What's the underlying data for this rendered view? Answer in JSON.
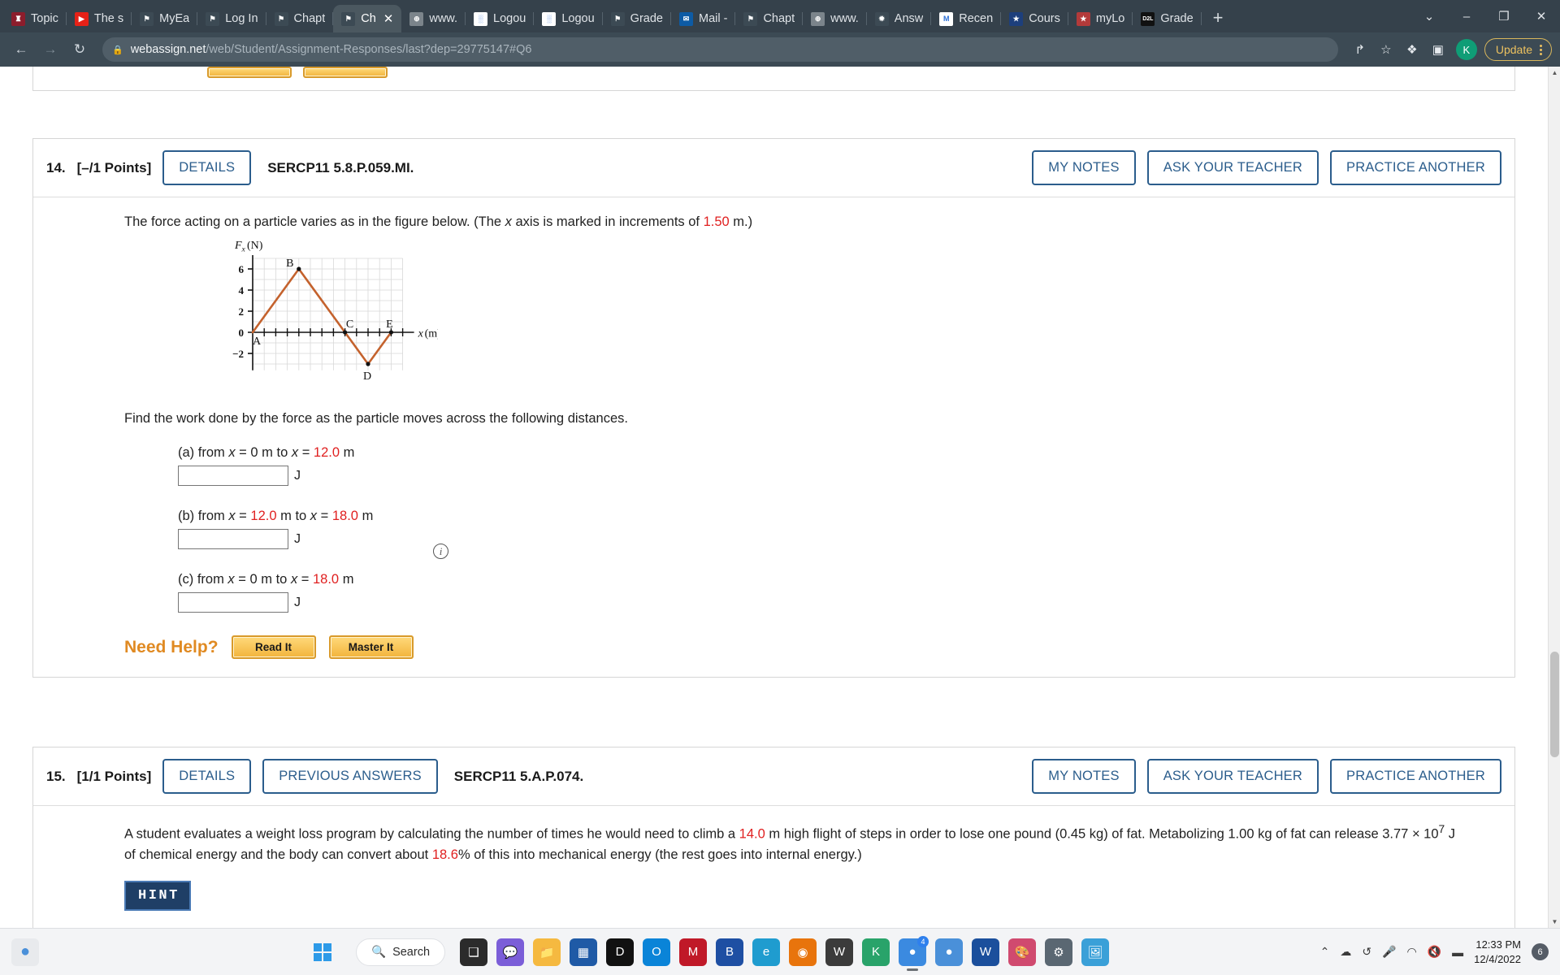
{
  "browser": {
    "tabs": [
      {
        "label": "Topic",
        "favicon": "maroon-shield-icon",
        "active": false
      },
      {
        "label": "The s",
        "favicon": "youtube-icon",
        "active": false
      },
      {
        "label": "MyEa",
        "favicon": "hcc-icon",
        "active": false
      },
      {
        "label": "Log In",
        "favicon": "hcc-icon",
        "active": false
      },
      {
        "label": "Chapt",
        "favicon": "hcc-icon",
        "active": false
      },
      {
        "label": "Ch",
        "favicon": "webassign-icon",
        "active": true
      },
      {
        "label": "www.",
        "favicon": "globe-icon",
        "active": false
      },
      {
        "label": "Logou",
        "favicon": "blue-pattern-icon",
        "active": false
      },
      {
        "label": "Logou",
        "favicon": "blue-pattern-icon",
        "active": false
      },
      {
        "label": "Grade",
        "favicon": "hcc-icon",
        "active": false
      },
      {
        "label": "Mail -",
        "favicon": "outlook-icon",
        "active": false
      },
      {
        "label": "Chapt",
        "favicon": "hcc-icon",
        "active": false
      },
      {
        "label": "www.",
        "favicon": "globe-icon",
        "active": false
      },
      {
        "label": "Answ",
        "favicon": "chegg-icon",
        "active": false
      },
      {
        "label": "Recen",
        "favicon": "gmail-icon",
        "active": false
      },
      {
        "label": "Cours",
        "favicon": "star-badge-icon",
        "active": false
      },
      {
        "label": "myLo",
        "favicon": "texas-icon",
        "active": false
      },
      {
        "label": "Grade",
        "favicon": "d2l-icon",
        "active": false
      }
    ],
    "tab_close_glyph": "✕",
    "new_tab_glyph": "+",
    "window_controls": [
      "⌄",
      "–",
      "❐",
      "✕"
    ],
    "nav": {
      "back_glyph": "←",
      "forward_glyph": "→",
      "reload_glyph": "↻",
      "lock_glyph": "🔒"
    },
    "url": {
      "domain": "webassign.net",
      "path": "/web/Student/Assignment-Responses/last?dep=29775147#Q6"
    },
    "toolbar": {
      "share_glyph": "↱",
      "bookmark_glyph": "☆",
      "extensions_glyph": "❖",
      "sidepanel_glyph": "▣",
      "profile_initial": "K",
      "update_label": "Update"
    }
  },
  "questions": [
    {
      "number": "14.",
      "points": "[–/1 Points]",
      "details_label": "DETAILS",
      "previous_answers_label": null,
      "code": "SERCP11 5.8.P.059.MI.",
      "right_buttons": [
        "MY NOTES",
        "ASK YOUR TEACHER",
        "PRACTICE ANOTHER"
      ],
      "prompt_pre": "The force acting on a particle varies as in the figure below. (The ",
      "prompt_italic": "x",
      "prompt_mid": " axis is marked in increments of ",
      "prompt_value": "1.50",
      "prompt_post": " m.)",
      "sub_prompt": "Find the work done by the force as the particle moves across the following distances.",
      "parts": [
        {
          "label": "(a) from ",
          "var1": "x",
          "eq1": " = ",
          "v1": "0",
          "u1": " m to ",
          "var2": "x",
          "eq2": " = ",
          "v2": "12.0",
          "u2": " m",
          "v1_red": false,
          "v2_red": true,
          "value": "",
          "unit": "J"
        },
        {
          "label": "(b) from ",
          "var1": "x",
          "eq1": " = ",
          "v1": "12.0",
          "u1": " m to ",
          "var2": "x",
          "eq2": " = ",
          "v2": "18.0",
          "u2": " m",
          "v1_red": true,
          "v2_red": true,
          "value": "",
          "unit": "J"
        },
        {
          "label": "(c) from ",
          "var1": "x",
          "eq1": " = ",
          "v1": "0",
          "u1": " m to ",
          "var2": "x",
          "eq2": " = ",
          "v2": "18.0",
          "u2": " m",
          "v1_red": false,
          "v2_red": true,
          "value": "",
          "unit": "J"
        }
      ],
      "need_help_label": "Need Help?",
      "help_buttons": [
        "Read It",
        "Master It"
      ],
      "info_icon_glyph": "i"
    },
    {
      "number": "15.",
      "points": "[1/1 Points]",
      "details_label": "DETAILS",
      "previous_answers_label": "PREVIOUS ANSWERS",
      "code": "SERCP11 5.A.P.074.",
      "right_buttons": [
        "MY NOTES",
        "ASK YOUR TEACHER",
        "PRACTICE ANOTHER"
      ],
      "prompt_seg1": "A student evaluates a weight loss program by calculating the number of times he would need to climb a ",
      "prompt_red1": "14.0",
      "prompt_seg2": " m high flight of steps in order to lose one pound (0.45 kg) of fat. Metabolizing 1.00 kg of fat can release 3.77 × 10",
      "prompt_sup": "7",
      "prompt_seg3": " J of chemical energy and the body can convert about ",
      "prompt_red2": "18.6",
      "prompt_seg4": "% of this into mechanical energy (the rest goes into internal energy.)",
      "hint_label": "HINT"
    }
  ],
  "chart_data": {
    "type": "line",
    "title": "",
    "ylabel": "F_x (N)",
    "xlabel": "x (m)",
    "xlim": [
      -1,
      13
    ],
    "ylim": [
      -3.6,
      7
    ],
    "grid": true,
    "x_tick_increment_m": 1.5,
    "y_ticks": [
      -2,
      0,
      2,
      4,
      6
    ],
    "y_tick_labels": [
      "−2",
      "0",
      "2",
      "4",
      "6"
    ],
    "series": [
      {
        "name": "Fx vs x",
        "color": "#c4622d",
        "x": [
          0,
          4,
          8,
          10,
          12
        ],
        "y": [
          0,
          6,
          0,
          -3,
          0
        ]
      }
    ],
    "point_labels": [
      {
        "name": "A",
        "x": 0,
        "y": 0,
        "dot": false,
        "pos": "below-right"
      },
      {
        "name": "B",
        "x": 4,
        "y": 6,
        "dot": true,
        "pos": "left"
      },
      {
        "name": "C",
        "x": 8,
        "y": 0,
        "dot": true,
        "pos": "above-right"
      },
      {
        "name": "D",
        "x": 10,
        "y": -3,
        "dot": true,
        "pos": "below"
      },
      {
        "name": "E",
        "x": 12,
        "y": 0,
        "dot": true,
        "pos": "above-left"
      }
    ]
  },
  "scrollbar": {
    "up_glyph": "▲",
    "down_glyph": "▼"
  },
  "taskbar": {
    "start_glyph": "",
    "search_label": "Search",
    "search_icon": "search-icon",
    "apps": [
      {
        "name": "task-view-icon",
        "glyph": "❑",
        "color": "#2b2b2b",
        "active": false
      },
      {
        "name": "chat-icon",
        "glyph": "💬",
        "color": "#7b5ed8",
        "active": false
      },
      {
        "name": "file-explorer-icon",
        "glyph": "📁",
        "color": "#f5b940",
        "active": true
      },
      {
        "name": "microsoft-store-icon",
        "glyph": "▦",
        "color": "#1f5aa6",
        "active": false
      },
      {
        "name": "dell-icon",
        "glyph": "D",
        "color": "#111111",
        "active": false
      },
      {
        "name": "alexa-icon",
        "glyph": "O",
        "color": "#0a84d8",
        "active": false
      },
      {
        "name": "mcafee-icon",
        "glyph": "M",
        "color": "#c01928",
        "active": false
      },
      {
        "name": "bluejeans-icon",
        "glyph": "B",
        "color": "#1e4fa3",
        "active": false
      },
      {
        "name": "edge-icon",
        "glyph": "e",
        "color": "#1f9ccf",
        "active": false
      },
      {
        "name": "firefox-icon",
        "glyph": "◉",
        "color": "#e8740c",
        "active": false
      },
      {
        "name": "webassign-icon",
        "glyph": "W",
        "color": "#3b3b3b",
        "active": false
      },
      {
        "name": "kahoot-icon",
        "glyph": "K",
        "color": "#29a36a",
        "active": true
      },
      {
        "name": "chrome-icon",
        "glyph": "●",
        "color": "#3b8ae0",
        "active": true,
        "badge": "4"
      },
      {
        "name": "chrome-alt-icon",
        "glyph": "●",
        "color": "#4a90d9",
        "active": false
      },
      {
        "name": "word-icon",
        "glyph": "W",
        "color": "#1b4f9c",
        "active": false
      },
      {
        "name": "paint-icon",
        "glyph": "🎨",
        "color": "#d04a6f",
        "active": false
      },
      {
        "name": "settings-icon",
        "glyph": "⚙",
        "color": "#5a6772",
        "active": false
      },
      {
        "name": "photos-icon",
        "glyph": "🖼",
        "color": "#3aa0d8",
        "active": false
      }
    ],
    "tray": {
      "chevron_glyph": "⌃",
      "onedrive_glyph": "☁",
      "sync_glyph": "↺",
      "mic_glyph": "🎤",
      "wifi_glyph": "◠",
      "volume_glyph": "🔇",
      "battery_glyph": "▬"
    },
    "clock_time": "12:33 PM",
    "clock_date": "12/4/2022",
    "notification_count": "6"
  }
}
